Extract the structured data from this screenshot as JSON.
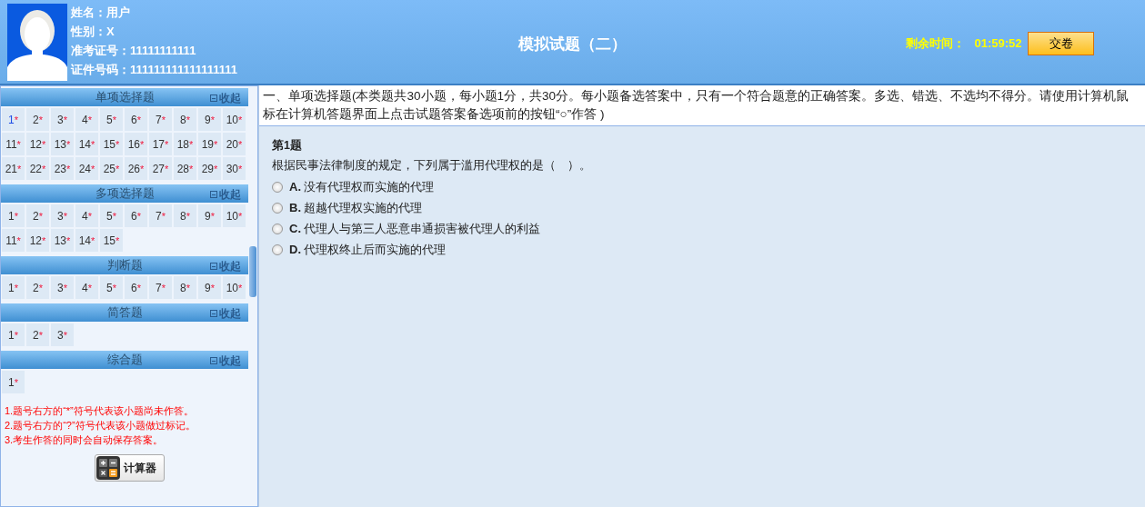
{
  "candidate": {
    "fields": [
      {
        "label": "姓名：",
        "value": "用户"
      },
      {
        "label": "性别：",
        "value": "X"
      },
      {
        "label": "准考证号：",
        "value": "11111111111"
      },
      {
        "label": "证件号码：",
        "value": "111111111111111111"
      }
    ]
  },
  "exam_title": "模拟试题（二）",
  "timer": {
    "label": "剩余时间：",
    "value": "01:59:52"
  },
  "submit_button": "交卷",
  "sections": [
    {
      "title": "单项选择题",
      "collapse": "收起",
      "questions": [
        {
          "number": "1",
          "mark": "*",
          "selected": true
        },
        {
          "number": "2",
          "mark": "*",
          "selected": false
        },
        {
          "number": "3",
          "mark": "*",
          "selected": false
        },
        {
          "number": "4",
          "mark": "*",
          "selected": false
        },
        {
          "number": "5",
          "mark": "*",
          "selected": false
        },
        {
          "number": "6",
          "mark": "*",
          "selected": false
        },
        {
          "number": "7",
          "mark": "*",
          "selected": false
        },
        {
          "number": "8",
          "mark": "*",
          "selected": false
        },
        {
          "number": "9",
          "mark": "*",
          "selected": false
        },
        {
          "number": "10",
          "mark": "*",
          "selected": false
        },
        {
          "number": "11",
          "mark": "*",
          "selected": false
        },
        {
          "number": "12",
          "mark": "*",
          "selected": false
        },
        {
          "number": "13",
          "mark": "*",
          "selected": false
        },
        {
          "number": "14",
          "mark": "*",
          "selected": false
        },
        {
          "number": "15",
          "mark": "*",
          "selected": false
        },
        {
          "number": "16",
          "mark": "*",
          "selected": false
        },
        {
          "number": "17",
          "mark": "*",
          "selected": false
        },
        {
          "number": "18",
          "mark": "*",
          "selected": false
        },
        {
          "number": "19",
          "mark": "*",
          "selected": false
        },
        {
          "number": "20",
          "mark": "*",
          "selected": false
        },
        {
          "number": "21",
          "mark": "*",
          "selected": false
        },
        {
          "number": "22",
          "mark": "*",
          "selected": false
        },
        {
          "number": "23",
          "mark": "*",
          "selected": false
        },
        {
          "number": "24",
          "mark": "*",
          "selected": false
        },
        {
          "number": "25",
          "mark": "*",
          "selected": false
        },
        {
          "number": "26",
          "mark": "*",
          "selected": false
        },
        {
          "number": "27",
          "mark": "*",
          "selected": false
        },
        {
          "number": "28",
          "mark": "*",
          "selected": false
        },
        {
          "number": "29",
          "mark": "*",
          "selected": false
        },
        {
          "number": "30",
          "mark": "*",
          "selected": false
        }
      ]
    },
    {
      "title": "多项选择题",
      "collapse": "收起",
      "questions": [
        {
          "number": "1",
          "mark": "*",
          "selected": false
        },
        {
          "number": "2",
          "mark": "*",
          "selected": false
        },
        {
          "number": "3",
          "mark": "*",
          "selected": false
        },
        {
          "number": "4",
          "mark": "*",
          "selected": false
        },
        {
          "number": "5",
          "mark": "*",
          "selected": false
        },
        {
          "number": "6",
          "mark": "*",
          "selected": false
        },
        {
          "number": "7",
          "mark": "*",
          "selected": false
        },
        {
          "number": "8",
          "mark": "*",
          "selected": false
        },
        {
          "number": "9",
          "mark": "*",
          "selected": false
        },
        {
          "number": "10",
          "mark": "*",
          "selected": false
        },
        {
          "number": "11",
          "mark": "*",
          "selected": false
        },
        {
          "number": "12",
          "mark": "*",
          "selected": false
        },
        {
          "number": "13",
          "mark": "*",
          "selected": false
        },
        {
          "number": "14",
          "mark": "*",
          "selected": false
        },
        {
          "number": "15",
          "mark": "*",
          "selected": false
        }
      ]
    },
    {
      "title": "判断题",
      "collapse": "收起",
      "questions": [
        {
          "number": "1",
          "mark": "*",
          "selected": false
        },
        {
          "number": "2",
          "mark": "*",
          "selected": false
        },
        {
          "number": "3",
          "mark": "*",
          "selected": false
        },
        {
          "number": "4",
          "mark": "*",
          "selected": false
        },
        {
          "number": "5",
          "mark": "*",
          "selected": false
        },
        {
          "number": "6",
          "mark": "*",
          "selected": false
        },
        {
          "number": "7",
          "mark": "*",
          "selected": false
        },
        {
          "number": "8",
          "mark": "*",
          "selected": false
        },
        {
          "number": "9",
          "mark": "*",
          "selected": false
        },
        {
          "number": "10",
          "mark": "*",
          "selected": false
        }
      ]
    },
    {
      "title": "简答题",
      "collapse": "收起",
      "questions": [
        {
          "number": "1",
          "mark": "*",
          "selected": false
        },
        {
          "number": "2",
          "mark": "*",
          "selected": false
        },
        {
          "number": "3",
          "mark": "*",
          "selected": false
        }
      ]
    },
    {
      "title": "综合题",
      "collapse": "收起",
      "questions": [
        {
          "number": "1",
          "mark": "*",
          "selected": false
        }
      ]
    }
  ],
  "notes": [
    "1.题号右方的“*”符号代表该小题尚未作答。",
    "2.题号右方的“?”符号代表该小题做过标记。",
    "3.考生作答的同时会自动保存答案。"
  ],
  "calculator_button": "计算器",
  "instructions": "一、单项选择题(本类题共30小题，每小题1分，共30分。每小题备选答案中，只有一个符合题意的正确答案。多选、错选、不选均不得分。请使用计算机鼠标在计算机答题界面上点击试题答案备选项前的按钮“○”作答 )",
  "question": {
    "number": "第1题",
    "text": "根据民事法律制度的规定，下列属于滥用代理权的是（　）。",
    "options": [
      {
        "letter": "A.",
        "text": "没有代理权而实施的代理",
        "selected": false
      },
      {
        "letter": "B.",
        "text": "超越代理权实施的代理",
        "selected": false
      },
      {
        "letter": "C.",
        "text": "代理人与第三人恶意串通损害被代理人的利益",
        "selected": false
      },
      {
        "letter": "D.",
        "text": "代理权终止后而实施的代理",
        "selected": false
      }
    ]
  }
}
